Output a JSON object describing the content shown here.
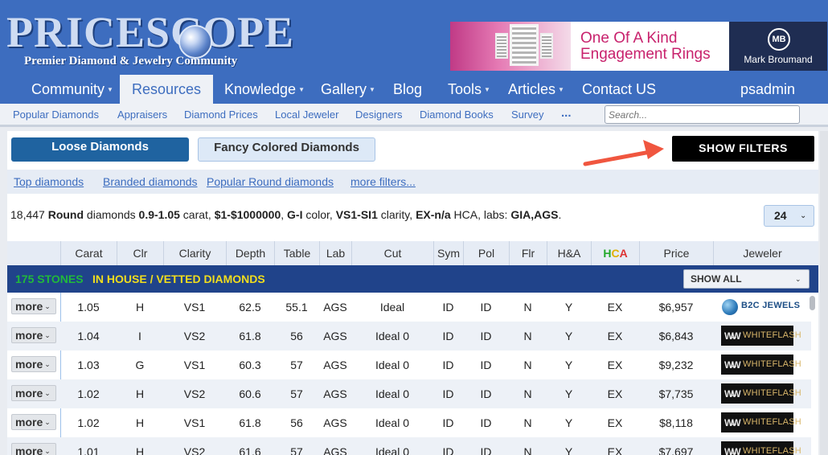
{
  "header": {
    "logo_word": "PRICESCOPE",
    "logo_tagline": "Premier Diamond & Jewelry Community",
    "ad_text": "One Of A Kind Engagement Rings",
    "ad_brand_mark": "MB",
    "ad_brand": "Mark Broumand"
  },
  "nav": {
    "items": [
      "Community",
      "Resources",
      "Knowledge",
      "Gallery",
      "Blog",
      "Tools",
      "Articles",
      "Contact US"
    ],
    "active": "Resources",
    "user": "psadmin"
  },
  "subnav": {
    "items": [
      "Popular Diamonds",
      "Appraisers",
      "Diamond Prices",
      "Local Jeweler",
      "Designers",
      "Diamond Books",
      "Survey"
    ],
    "more": "...",
    "search_placeholder": "Search..."
  },
  "tabs": {
    "loose": "Loose Diamonds",
    "fancy": "Fancy Colored Diamonds",
    "show_filters": "SHOW FILTERS"
  },
  "quick_links": [
    "Top diamonds",
    "Branded diamonds",
    "Popular Round diamonds",
    "more filters..."
  ],
  "summary": {
    "count": "18,447",
    "shape": "Round",
    "carat": "0.9-1.05",
    "price": "$1-$1000000",
    "color": "G-I",
    "clarity": "VS1-SI1",
    "hca": "EX-n/a",
    "labs": "GIA,AGS",
    "t_diamonds": " diamonds ",
    "t_carat": " carat, ",
    "t_color": " color, ",
    "t_clarity": " clarity, ",
    "t_hca": " HCA, labs: ",
    "t_end": "."
  },
  "per_page": "24",
  "table": {
    "columns": [
      "Carat",
      "Clr",
      "Clarity",
      "Depth",
      "Table",
      "Lab",
      "Cut",
      "Sym",
      "Pol",
      "Flr",
      "H&A",
      "HCA",
      "Price",
      "Jeweler"
    ],
    "inhouse_count": "175  STONES",
    "inhouse_label": "IN HOUSE  / VETTED DIAMONDS",
    "show_all": "SHOW ALL",
    "more_label": "more",
    "rows": [
      {
        "carat": "1.05",
        "clr": "H",
        "clarity": "VS1",
        "depth": "62.5",
        "table": "55.1",
        "lab": "AGS",
        "cut": "Ideal",
        "sym": "ID",
        "pol": "ID",
        "flr": "N",
        "ha": "Y",
        "hca": "EX",
        "price": "$6,957",
        "jeweler": "B2C JEWELS",
        "jeweler_type": "b2c"
      },
      {
        "carat": "1.04",
        "clr": "I",
        "clarity": "VS2",
        "depth": "61.8",
        "table": "56",
        "lab": "AGS",
        "cut": "Ideal 0",
        "sym": "ID",
        "pol": "ID",
        "flr": "N",
        "ha": "Y",
        "hca": "EX",
        "price": "$6,843",
        "jeweler": "WHITEFLASH",
        "jeweler_type": "wf"
      },
      {
        "carat": "1.03",
        "clr": "G",
        "clarity": "VS1",
        "depth": "60.3",
        "table": "57",
        "lab": "AGS",
        "cut": "Ideal 0",
        "sym": "ID",
        "pol": "ID",
        "flr": "N",
        "ha": "Y",
        "hca": "EX",
        "price": "$9,232",
        "jeweler": "WHITEFLASH",
        "jeweler_type": "wf"
      },
      {
        "carat": "1.02",
        "clr": "H",
        "clarity": "VS2",
        "depth": "60.6",
        "table": "57",
        "lab": "AGS",
        "cut": "Ideal 0",
        "sym": "ID",
        "pol": "ID",
        "flr": "N",
        "ha": "Y",
        "hca": "EX",
        "price": "$7,735",
        "jeweler": "WHITEFLASH",
        "jeweler_type": "wf"
      },
      {
        "carat": "1.02",
        "clr": "H",
        "clarity": "VS1",
        "depth": "61.8",
        "table": "56",
        "lab": "AGS",
        "cut": "Ideal 0",
        "sym": "ID",
        "pol": "ID",
        "flr": "N",
        "ha": "Y",
        "hca": "EX",
        "price": "$8,118",
        "jeweler": "WHITEFLASH",
        "jeweler_type": "wf"
      },
      {
        "carat": "1.01",
        "clr": "H",
        "clarity": "VS2",
        "depth": "61.6",
        "table": "57",
        "lab": "AGS",
        "cut": "Ideal 0",
        "sym": "ID",
        "pol": "ID",
        "flr": "N",
        "ha": "Y",
        "hca": "EX",
        "price": "$7,697",
        "jeweler": "WHITEFLASH",
        "jeweler_type": "wf"
      }
    ]
  },
  "colors": {
    "brand_blue": "#3d6dbf",
    "banner_navy": "#20438a",
    "count_green": "#21b93a",
    "label_yellow": "#f1dd1d",
    "arrow_red": "#f0563f"
  }
}
